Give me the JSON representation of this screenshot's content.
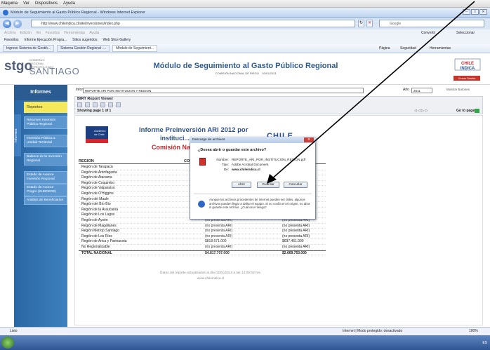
{
  "vm_menu": [
    "Máquina",
    "Ver",
    "Dispositivos",
    "Ayuda"
  ],
  "window_title": "Módulo de Seguimiento al Gasto Público Regional - Windows Internet Explorer",
  "address": "http://www.chileindica.cl/site/inversiones/index.php",
  "search_placeholder": "Google",
  "ie_menu": [
    "Archivo",
    "Edición",
    "Ver",
    "Favoritos",
    "Herramientas",
    "Ayuda"
  ],
  "convert_label": "Convertir",
  "select_label": "Seleccionar",
  "favorites": [
    "Favoritos",
    "Informe Ejecución Progra...",
    "Sitios sugeridos",
    "Web Slice Gallery"
  ],
  "tabs": [
    "Ingreso Sistema de Gestió...",
    "Sistema Gestión Regional -...",
    "Módulo de Seguimient..."
  ],
  "toolbar_right": [
    "Página",
    "Seguridad",
    "Herramientas"
  ],
  "header": {
    "logo": "stgo",
    "logo_small": "GOBIERNO REGIONAL METROPOLITANO DE",
    "logo_big": "SANTIAGO",
    "title": "Módulo de Seguimiento al Gasto Público Regional",
    "subtitle": "COMISIÓN NACIONAL DE RIEGO",
    "date": "03/01/2013",
    "chile_logo": "CHILE INDICA",
    "cerrar": "Cerrar Sesión"
  },
  "sidebar": {
    "title": "Informes",
    "reportes": "Reportes",
    "vertical_tab": "Informes",
    "items": [
      "Resumen Inversión Pública Regional",
      "Inversión Pública a Unidad Territorial",
      "Balance de la Inversión Regional",
      "Estado de Avance Inversión Regional",
      "Estado de Avance Progor (SUBDERE)",
      "Análisis de Beneficiarios"
    ]
  },
  "filters": {
    "informe_label": "Informe",
    "informe_value": "REPORTE ARI POR INSTITUCION Y REGION",
    "anio_label": "Año",
    "anio_value": "2011",
    "mostrar": "Mostrar Botones"
  },
  "viewer": {
    "title": "BIRT Report Viewer",
    "page": "Showing page  1  of  1",
    "goto": "Go to page:"
  },
  "report": {
    "gob": "Gobierno de Chile",
    "title1": "Informe Preinversión ARI 2012 por",
    "title2": "instituci...",
    "title3": "Comisión Nac...",
    "chile": "CHILE",
    "col_region": "REGION",
    "col_cost": "COS",
    "rows": [
      {
        "region": "Región de Tarapacá",
        "c2": "",
        "c3": ""
      },
      {
        "region": "Región de Antofagasta",
        "c2": "",
        "c3": ""
      },
      {
        "region": "Región de Atacama",
        "c2": "",
        "c3": ""
      },
      {
        "region": "Región de Coquimbo",
        "c2": "",
        "c3": ""
      },
      {
        "region": "Región de Valparaíso",
        "c2": "",
        "c3": ""
      },
      {
        "region": "Región de O'Higgins",
        "c2": "",
        "c3": ""
      },
      {
        "region": "Región del Maule",
        "c2": "",
        "c3": ""
      },
      {
        "region": "Región del Bío Bío",
        "c2": "",
        "c3": ""
      },
      {
        "region": "Región de la Araucanía",
        "c2": "",
        "c3": ""
      },
      {
        "region": "Región de Los Lagos",
        "c2": "(no presenta ARI)",
        "c3": "(no presenta ARI)"
      },
      {
        "region": "Región de Aysén",
        "c2": "(no presenta ARI)",
        "c3": "(no presenta ARI)"
      },
      {
        "region": "Región de Magallanes",
        "c2": "(no presenta ARI)",
        "c3": "(no presenta ARI)"
      },
      {
        "region": "Región Metrop Santiago",
        "c2": "(no presenta ARI)",
        "c3": "(no presenta ARI)"
      },
      {
        "region": "Región de Los Ríos",
        "c2": "(no presenta ARI)",
        "c3": "(no presenta ARI)"
      },
      {
        "region": "Región de Arica y Parinacota",
        "c2": "$818.671.000",
        "c3": "$697.461.000"
      },
      {
        "region": "No Regionalizable",
        "c2": "(no presenta ARI)",
        "c3": "(no presenta ARI)"
      }
    ],
    "total_label": "TOTAL NACIONAL",
    "total_c2": "$4.817.707.000",
    "total_c3": "$2.669.753.000",
    "note1": "Datos del reporte actualizados al día 03/01/2013 a las 14:05:03 hrs.",
    "note2": "www.chileindica.cl"
  },
  "dialog": {
    "title": "Descarga de archivos",
    "question": "¿Desea abrir o guardar este archivo?",
    "name_label": "Nombre:",
    "name_value": "REPORTE_ARI_POR_INSTITUCION_REGION.pdf",
    "type_label": "Tipo:",
    "type_value": "Adobe Acrobat Document",
    "from_label": "De:",
    "from_value": "www.chileindica.cl",
    "open": "Abrir",
    "save": "Guardar",
    "cancel": "Cancelar",
    "warning": "Aunque los archivos procedentes de Internet pueden ser útiles, algunos archivos pueden llegar a dañar el equipo. Si no confía en el origen, no abra ni guarde este archivo. ¿Cuál es el riesgo?"
  },
  "status": {
    "left": "Listo",
    "zone": "Internet | Modo protegido: desactivado",
    "zoom": "100%"
  },
  "taskbar": {
    "lang": "ES"
  }
}
